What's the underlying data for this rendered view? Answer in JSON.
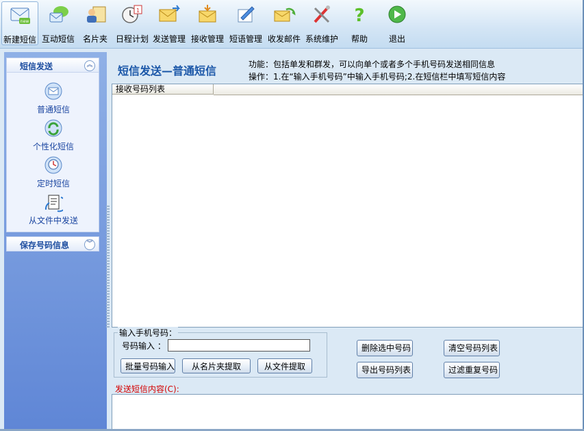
{
  "toolbar": {
    "items": [
      {
        "label": "新建短信",
        "icon": "new-sms-icon"
      },
      {
        "label": "互动短信",
        "icon": "interactive-sms-icon"
      },
      {
        "label": "名片夹",
        "icon": "contacts-icon"
      },
      {
        "label": "日程计划",
        "icon": "calendar-icon"
      },
      {
        "label": "发送管理",
        "icon": "send-mail-icon"
      },
      {
        "label": "接收管理",
        "icon": "receive-mail-icon"
      },
      {
        "label": "短语管理",
        "icon": "phrase-edit-icon"
      },
      {
        "label": "收发邮件",
        "icon": "email-exchange-icon"
      },
      {
        "label": "系统维护",
        "icon": "tools-icon"
      },
      {
        "label": "帮助",
        "icon": "help-icon"
      },
      {
        "label": "退出",
        "icon": "exit-icon"
      }
    ]
  },
  "sidebar": {
    "panel1_title": "短信发送",
    "items": [
      {
        "label": "普通短信",
        "icon": "sms-envelope-icon"
      },
      {
        "label": "个性化短信",
        "icon": "personalized-sms-icon"
      },
      {
        "label": "定时短信",
        "icon": "scheduled-sms-icon"
      },
      {
        "label": "从文件中发送",
        "icon": "send-from-file-icon"
      }
    ],
    "panel2_title": "保存号码信息"
  },
  "main": {
    "title": "短信发送—普通短信",
    "info_line1": "功能：包括单发和群发，可以向单个或者多个手机号码发送相同信息",
    "info_line2": "操作：1.在“输入手机号码”中输入手机号码;2.在短信栏中填写短信内容",
    "list_header": "接收号码列表",
    "group_legend": "输入手机号码：",
    "number_label": "号码输入 ：",
    "number_value": "",
    "buttons": {
      "batch_input": "批量号码输入",
      "from_contacts": "从名片夹提取",
      "from_file": "从文件提取",
      "delete_selected": "删除选中号码",
      "clear_list": "清空号码列表",
      "export_list": "导出号码列表",
      "filter_duplicates": "过滤重复号码"
    },
    "content_label": "发送短信内容(C):"
  },
  "colors": {
    "title_blue": "#1b57a8",
    "sidebar_top": "#8fb0e6",
    "sidebar_bottom": "#5f86d6",
    "content_label_red": "#d40000"
  }
}
